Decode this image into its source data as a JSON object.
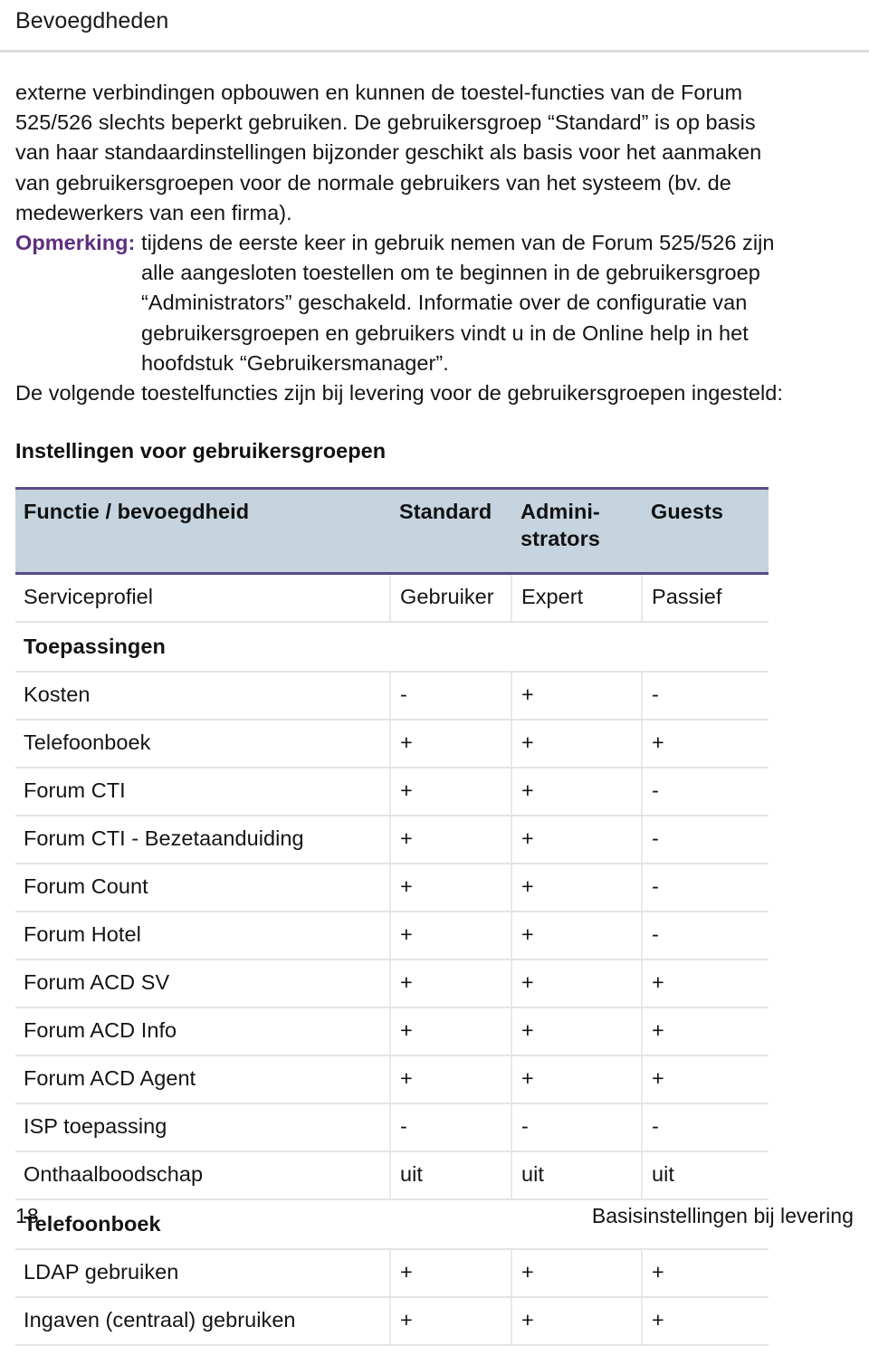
{
  "running_head": "Bevoegdheden",
  "paragraphs": {
    "intro": "externe verbindingen opbouwen en kunnen de toestel-functies van de Forum 525/526 slechts beperkt gebruiken. De gebruikersgroep “Standard” is op basis van haar standaardinstellingen bijzonder geschikt als basis voor het aanmaken van gebruikersgroepen voor de normale gebruikers van het systeem (bv. de medewerkers van een firma).",
    "note_label": "Opmerking:",
    "note_text": "tijdens de eerste keer in gebruik nemen van de Forum 525/526 zijn alle aangesloten toestellen om te beginnen in de gebruikersgroep “Administrators” geschakeld. Informatie over de configuratie van gebruikersgroepen en gebruikers vindt u in de Online help in het hoofdstuk “Gebruikersmanager”.",
    "after_note": "De volgende toestelfuncties zijn bij levering voor de gebruikersgroepen ingesteld:"
  },
  "sub_heading": "Instellingen voor gebruikersgroepen",
  "table": {
    "headers": [
      "Functie / bevoegdheid",
      "Standard",
      "Admini-\nstrators",
      "Guests"
    ],
    "rows": [
      {
        "type": "data",
        "cells": [
          "Serviceprofiel",
          "Gebruiker",
          "Expert",
          "Passief"
        ]
      },
      {
        "type": "section",
        "cells": [
          "Toepassingen",
          "",
          "",
          ""
        ]
      },
      {
        "type": "data",
        "cells": [
          "Kosten",
          "-",
          "+",
          "-"
        ]
      },
      {
        "type": "data",
        "cells": [
          "Telefoonboek",
          "+",
          "+",
          "+"
        ]
      },
      {
        "type": "data",
        "cells": [
          "Forum CTI",
          "+",
          "+",
          "-"
        ]
      },
      {
        "type": "data",
        "cells": [
          "Forum CTI - Bezetaanduiding",
          "+",
          "+",
          "-"
        ]
      },
      {
        "type": "data",
        "cells": [
          "Forum Count",
          "+",
          "+",
          "-"
        ]
      },
      {
        "type": "data",
        "cells": [
          "Forum Hotel",
          "+",
          "+",
          "-"
        ]
      },
      {
        "type": "data",
        "cells": [
          "Forum ACD SV",
          "+",
          "+",
          "+"
        ]
      },
      {
        "type": "data",
        "cells": [
          "Forum ACD Info",
          "+",
          "+",
          "+"
        ]
      },
      {
        "type": "data",
        "cells": [
          "Forum ACD Agent",
          "+",
          "+",
          "+"
        ]
      },
      {
        "type": "data",
        "cells": [
          "ISP toepassing",
          "-",
          "-",
          "-"
        ]
      },
      {
        "type": "data",
        "cells": [
          "Onthaalboodschap",
          "uit",
          "uit",
          "uit"
        ]
      },
      {
        "type": "section",
        "cells": [
          "Telefoonboek",
          "",
          "",
          ""
        ]
      },
      {
        "type": "data",
        "cells": [
          "LDAP gebruiken",
          "+",
          "+",
          "+"
        ]
      },
      {
        "type": "data",
        "cells": [
          "Ingaven (centraal) gebruiken",
          "+",
          "+",
          "+"
        ]
      }
    ]
  },
  "footer": {
    "page_number": "18",
    "title": "Basisinstellingen bij levering"
  },
  "colors": {
    "note_label": "#5d2e80",
    "table_header_bg": "#c5d4de",
    "table_header_border": "#5b4a86",
    "row_rule": "#e4e4e4",
    "head_rule": "#dcdcdc",
    "text": "#141414"
  }
}
